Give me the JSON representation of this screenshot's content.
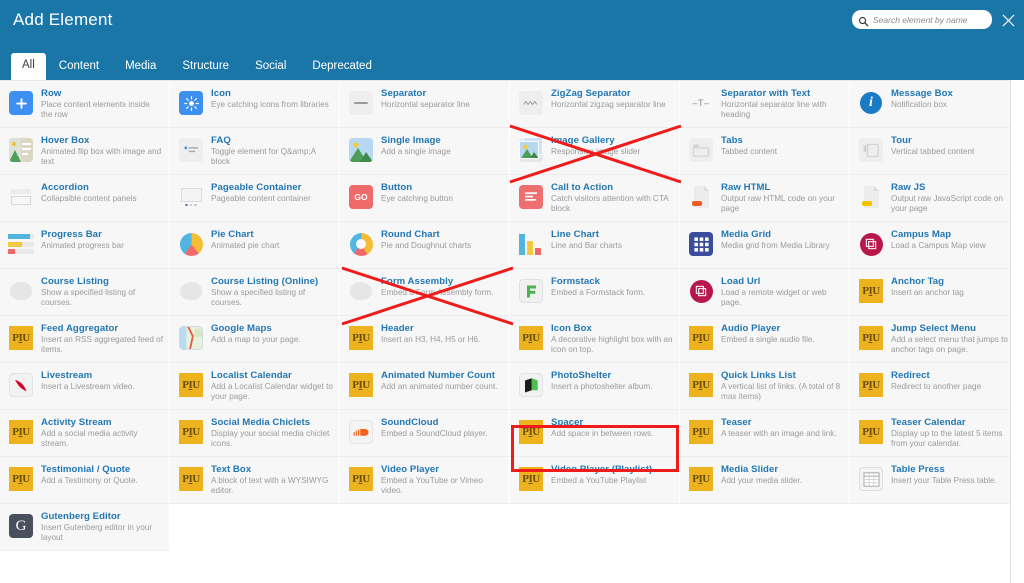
{
  "header": {
    "title": "Add Element",
    "search": {
      "placeholder": "Search element by name",
      "value": "",
      "icon": "search-icon"
    },
    "close": {
      "icon": "close-icon",
      "label": "Close"
    }
  },
  "tabs": [
    {
      "label": "All",
      "active": true
    },
    {
      "label": "Content",
      "active": false
    },
    {
      "label": "Media",
      "active": false
    },
    {
      "label": "Structure",
      "active": false
    },
    {
      "label": "Social",
      "active": false
    },
    {
      "label": "Deprecated",
      "active": false
    }
  ],
  "colors": {
    "header_bg": "#1b76a8",
    "title_link": "#2277b4",
    "annotation_red": "#f01b1b",
    "plu_gold": "#ecb31f",
    "cell_bg": "#f7f7f7"
  },
  "elements": [
    {
      "title": "Row",
      "desc": "Place content elements inside the row",
      "icon": "plus-square-icon"
    },
    {
      "title": "Icon",
      "desc": "Eye catching icons from libraries",
      "icon": "sun-icon"
    },
    {
      "title": "Separator",
      "desc": "Horizontal separator line",
      "icon": "horizontal-line-icon"
    },
    {
      "title": "ZigZag Separator",
      "desc": "Horizontal zigzag separator line",
      "icon": "zigzag-line-icon"
    },
    {
      "title": "Separator with Text",
      "desc": "Horizontal separator line with heading",
      "icon": "separator-with-text-icon"
    },
    {
      "title": "Message Box",
      "desc": "Notification box",
      "icon": "info-circle-icon"
    },
    {
      "title": "Hover Box",
      "desc": "Animated flip box with image and text",
      "icon": "hover-box-icon"
    },
    {
      "title": "FAQ",
      "desc": "Toggle element for Q&amp;A block",
      "icon": "faq-list-icon"
    },
    {
      "title": "Single Image",
      "desc": "Add a single image",
      "icon": "image-icon"
    },
    {
      "title": "Image Gallery",
      "desc": "Responsive image slider",
      "icon": "image-gallery-icon",
      "annotation": "crossed-out"
    },
    {
      "title": "Tabs",
      "desc": "Tabbed content",
      "icon": "tabs-icon"
    },
    {
      "title": "Tour",
      "desc": "Vertical tabbed content",
      "icon": "tour-icon"
    },
    {
      "title": "Accordion",
      "desc": "Collapsible content panels",
      "icon": "accordion-icon"
    },
    {
      "title": "Pageable Container",
      "desc": "Pageable content container",
      "icon": "pageable-container-icon"
    },
    {
      "title": "Button",
      "desc": "Eye catching button",
      "icon": "go-button-icon"
    },
    {
      "title": "Call to Action",
      "desc": "Catch visitors attention with CTA block",
      "icon": "cta-icon"
    },
    {
      "title": "Raw HTML",
      "desc": "Output raw HTML code on your page",
      "icon": "file-html-icon"
    },
    {
      "title": "Raw JS",
      "desc": "Output raw JavaScript code on your page",
      "icon": "file-js-icon"
    },
    {
      "title": "Progress Bar",
      "desc": "Animated progress bar",
      "icon": "progress-bar-icon"
    },
    {
      "title": "Pie Chart",
      "desc": "Animated pie chart",
      "icon": "pie-chart-icon"
    },
    {
      "title": "Round Chart",
      "desc": "Pie and Doughnut charts",
      "icon": "doughnut-chart-icon"
    },
    {
      "title": "Line Chart",
      "desc": "Line and Bar charts",
      "icon": "bar-chart-icon"
    },
    {
      "title": "Media Grid",
      "desc": "Media grid from Media Library",
      "icon": "media-grid-icon"
    },
    {
      "title": "Campus Map",
      "desc": "Load a Campus Map view",
      "icon": "campus-map-icon"
    },
    {
      "title": "Course Listing",
      "desc": "Show a specified listing of courses.",
      "icon": "blob-icon"
    },
    {
      "title": "Course Listing (Online)",
      "desc": "Show a specified listing of courses.",
      "icon": "blob-icon"
    },
    {
      "title": "Form Assembly",
      "desc": "Embed a Form Assembly form.",
      "icon": "blob-icon",
      "annotation": "crossed-out"
    },
    {
      "title": "Formstack",
      "desc": "Embed a Formstack form.",
      "icon": "formstack-icon"
    },
    {
      "title": "Load Url",
      "desc": "Load a remote widget or web page.",
      "icon": "load-url-icon"
    },
    {
      "title": "Anchor Tag",
      "desc": "Insert an anchor tag",
      "icon": "plu-icon"
    },
    {
      "title": "Feed Aggregator",
      "desc": "Insert an RSS aggregated feed of items.",
      "icon": "plu-icon"
    },
    {
      "title": "Google Maps",
      "desc": "Add a map to your page.",
      "icon": "google-maps-icon"
    },
    {
      "title": "Header",
      "desc": "Insert an H3, H4, H5 or H6.",
      "icon": "plu-icon"
    },
    {
      "title": "Icon Box",
      "desc": "A decorative highlight box with an icon on top.",
      "icon": "plu-icon"
    },
    {
      "title": "Audio Player",
      "desc": "Embed a single audio file.",
      "icon": "plu-icon"
    },
    {
      "title": "Jump Select Menu",
      "desc": "Add a select menu that jumps to anchor tags on page.",
      "icon": "plu-icon"
    },
    {
      "title": "Livestream",
      "desc": "Insert a Livestream video.",
      "icon": "livestream-icon"
    },
    {
      "title": "Localist Calendar",
      "desc": "Add a Localist Calendar widget to your page.",
      "icon": "plu-icon"
    },
    {
      "title": "Animated Number Count",
      "desc": "Add an animated number count.",
      "icon": "plu-icon"
    },
    {
      "title": "PhotoShelter",
      "desc": "Insert a photoshelter album.",
      "icon": "photoshelter-icon"
    },
    {
      "title": "Quick Links List",
      "desc": "A vertical list of links. (A total of 8 max items)",
      "icon": "plu-icon"
    },
    {
      "title": "Redirect",
      "desc": "Redirect to another page",
      "icon": "plu-icon"
    },
    {
      "title": "Activity Stream",
      "desc": "Add a social media activity stream.",
      "icon": "plu-icon"
    },
    {
      "title": "Social Media Chiclets",
      "desc": "Display your social media chiclet icons.",
      "icon": "plu-icon"
    },
    {
      "title": "SoundCloud",
      "desc": "Embed a SoundCloud player.",
      "icon": "soundcloud-icon"
    },
    {
      "title": "Spacer",
      "desc": "Add space in between rows.",
      "icon": "plu-icon",
      "annotation": "highlighted"
    },
    {
      "title": "Teaser",
      "desc": "A teaser with an image and link.",
      "icon": "plu-icon"
    },
    {
      "title": "Teaser Calendar",
      "desc": "Display up to the latest 5 items from your calendar.",
      "icon": "plu-icon"
    },
    {
      "title": "Testimonial / Quote",
      "desc": "Add a Testimony or Quote.",
      "icon": "plu-icon"
    },
    {
      "title": "Text Box",
      "desc": "A block of text with a WYSIWYG editor.",
      "icon": "plu-icon"
    },
    {
      "title": "Video Player",
      "desc": "Embed a YouTube or Vimeo video.",
      "icon": "plu-icon"
    },
    {
      "title": "Video Player (Playlist)",
      "desc": "Embed a YouTube Playlist",
      "icon": "plu-icon"
    },
    {
      "title": "Media Slider",
      "desc": "Add your media slider.",
      "icon": "plu-icon"
    },
    {
      "title": "Table Press",
      "desc": "Insert your Table Press table.",
      "icon": "table-press-icon"
    },
    {
      "title": "Gutenberg Editor",
      "desc": "Insert Gutenberg editor in your layout",
      "icon": "gutenberg-icon"
    }
  ]
}
